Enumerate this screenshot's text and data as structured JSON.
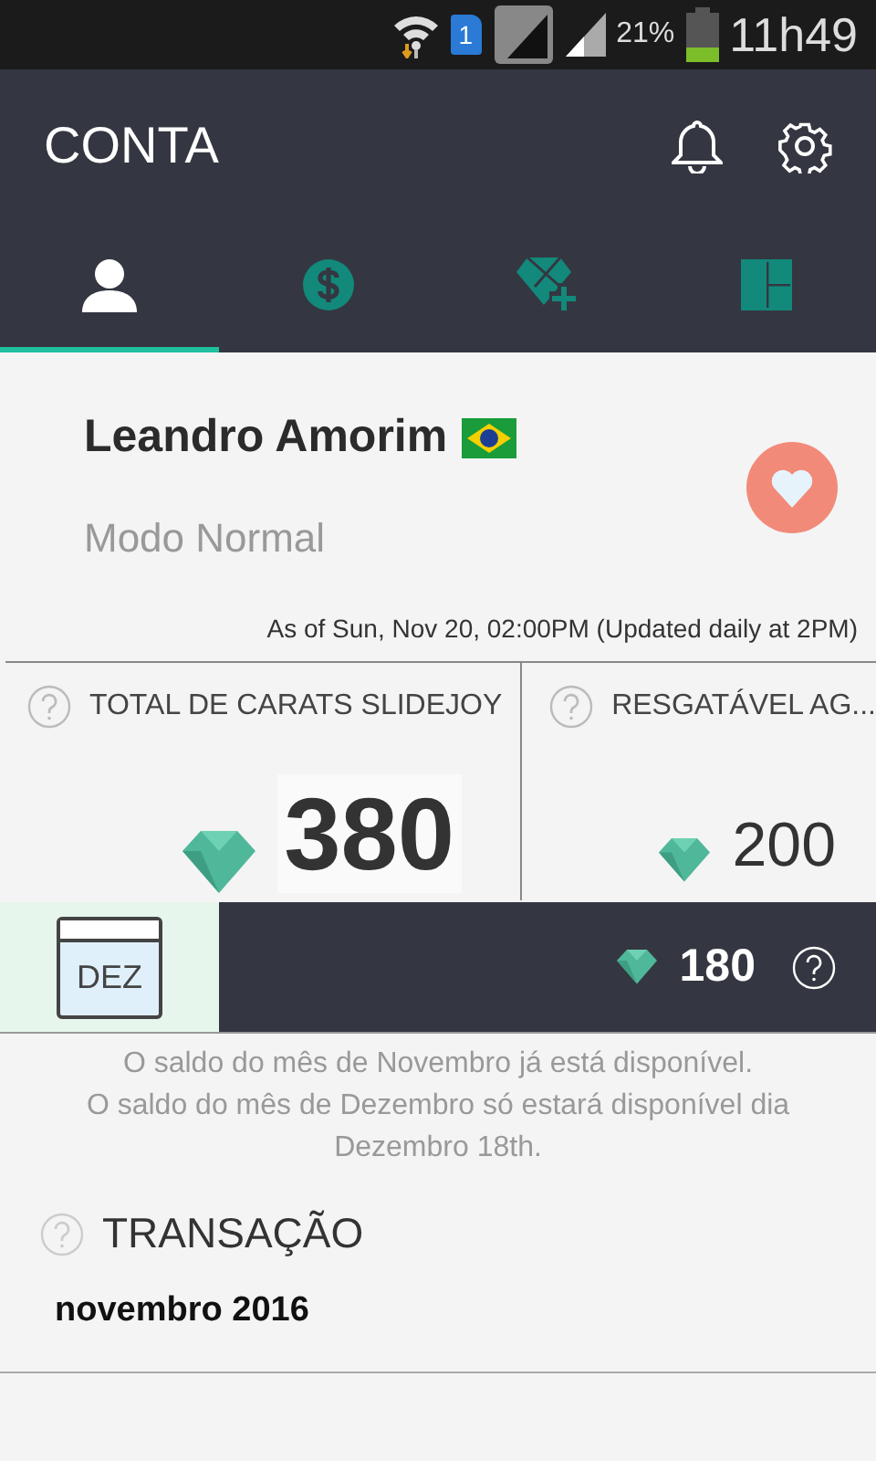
{
  "status_bar": {
    "sim": "1",
    "battery": "21%",
    "time": "11h49"
  },
  "app_bar": {
    "title": "CONTA"
  },
  "tabs": [
    {
      "kind": "person",
      "selected": true
    },
    {
      "kind": "dollar",
      "selected": false
    },
    {
      "kind": "diamond-plus",
      "selected": false
    },
    {
      "kind": "grid",
      "selected": false
    }
  ],
  "profile": {
    "name": "Leandro Amorim",
    "mode": "Modo Normal",
    "updated": "As of Sun, Nov 20, 02:00PM (Updated daily at 2PM)"
  },
  "stats": [
    {
      "label": "TOTAL DE CARATS SLIDEJOY",
      "value": "380",
      "kind": "large"
    },
    {
      "label": "RESGATÁVEL AG...",
      "value": "200",
      "kind": "small"
    }
  ],
  "month": {
    "label": "DEZ",
    "value": "180"
  },
  "message": [
    "O saldo do mês de Novembro já está disponível.",
    "O saldo do mês de Dezembro só estará disponível dia Dezembro 18th."
  ],
  "transactions": {
    "title": "TRANSAÇÃO",
    "groups": [
      "novembro 2016"
    ]
  }
}
